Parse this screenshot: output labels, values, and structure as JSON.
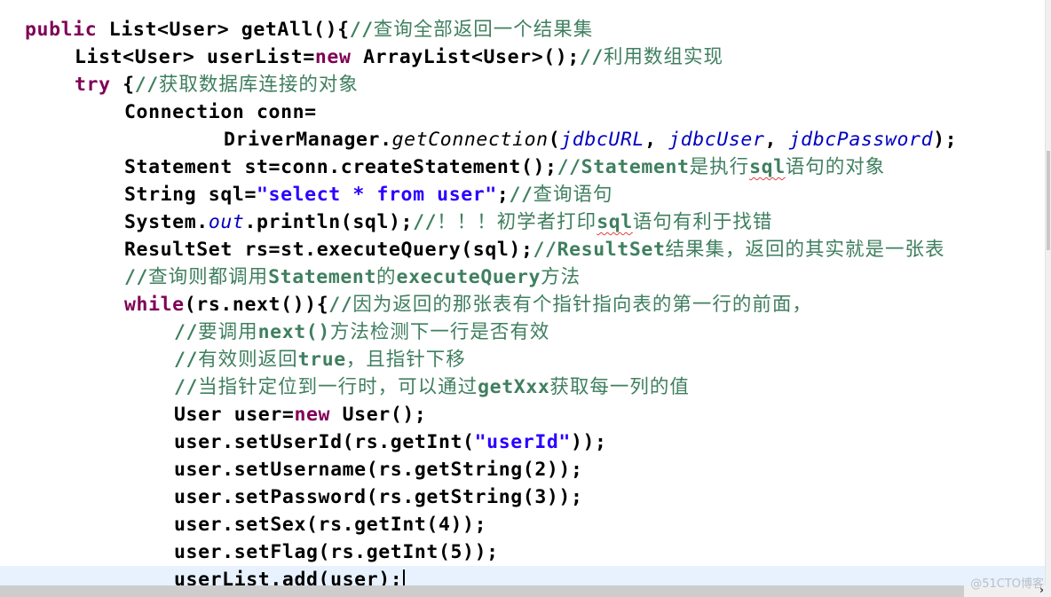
{
  "editor": {
    "language": "java",
    "colors": {
      "keyword": "#7f0055",
      "string": "#2a00ff",
      "field": "#0000c0",
      "comment": "#3f7f5f",
      "current_line": "#e8f2fe"
    },
    "lines": [
      {
        "indent": 0,
        "tokens": [
          {
            "t": "kw",
            "v": "public"
          },
          {
            "t": "p",
            "v": " List<User> getAll(){"
          },
          {
            "t": "cm",
            "v": "//",
            "cjk": "查询全部返回一个结果集"
          }
        ]
      },
      {
        "indent": 1,
        "tokens": [
          {
            "t": "p",
            "v": "List<User> userList="
          },
          {
            "t": "kw",
            "v": "new"
          },
          {
            "t": "p",
            "v": " ArrayList<User>();"
          },
          {
            "t": "cm",
            "v": "//",
            "cjk": "利用数组实现"
          }
        ]
      },
      {
        "indent": 1,
        "tokens": [
          {
            "t": "kw",
            "v": "try"
          },
          {
            "t": "p",
            "v": " {"
          },
          {
            "t": "cm",
            "v": "//",
            "cjk": "获取数据库连接的对象"
          }
        ]
      },
      {
        "indent": 2,
        "tokens": [
          {
            "t": "p",
            "v": "Connection conn="
          }
        ]
      },
      {
        "indent": 4,
        "tokens": [
          {
            "t": "p",
            "v": "DriverManager."
          },
          {
            "t": "sm",
            "v": "getConnection"
          },
          {
            "t": "p",
            "v": "("
          },
          {
            "t": "f",
            "v": "jdbcURL"
          },
          {
            "t": "p",
            "v": ", "
          },
          {
            "t": "f",
            "v": "jdbcUser"
          },
          {
            "t": "p",
            "v": ", "
          },
          {
            "t": "f",
            "v": "jdbcPassword"
          },
          {
            "t": "p",
            "v": ");"
          }
        ]
      },
      {
        "indent": 2,
        "tokens": [
          {
            "t": "p",
            "v": "Statement st=conn.createStatement();"
          },
          {
            "t": "cm",
            "v": "//Statement",
            "cjk": "是执行"
          },
          {
            "t": "cmsq",
            "v": "sql"
          },
          {
            "t": "cm",
            "v": "",
            "cjk": "语句的对象"
          }
        ]
      },
      {
        "indent": 2,
        "tokens": [
          {
            "t": "p",
            "v": "String sql="
          },
          {
            "t": "str",
            "v": "\"select * from user\""
          },
          {
            "t": "p",
            "v": ";"
          },
          {
            "t": "cm",
            "v": "//",
            "cjk": "查询语句"
          }
        ]
      },
      {
        "indent": 2,
        "tokens": [
          {
            "t": "p",
            "v": "System."
          },
          {
            "t": "sf",
            "v": "out"
          },
          {
            "t": "p",
            "v": ".println(sql);"
          },
          {
            "t": "cm",
            "v": "//",
            "cjk": "！！！初学者打印"
          },
          {
            "t": "cmsq",
            "v": "sql"
          },
          {
            "t": "cm",
            "v": "",
            "cjk": "语句有利于找错"
          }
        ]
      },
      {
        "indent": 2,
        "tokens": [
          {
            "t": "p",
            "v": "ResultSet rs=st.executeQuery(sql);"
          },
          {
            "t": "cm",
            "v": "//ResultSet",
            "cjk": "结果集，返回的其实就是一张表"
          }
        ]
      },
      {
        "indent": 2,
        "tokens": [
          {
            "t": "cm",
            "v": "//",
            "cjk": "查询则都调用"
          },
          {
            "t": "cm",
            "v": "Statement",
            "cjk": "的"
          },
          {
            "t": "cm",
            "v": "executeQuery",
            "cjk": "方法"
          }
        ]
      },
      {
        "indent": 2,
        "tokens": [
          {
            "t": "kw",
            "v": "while"
          },
          {
            "t": "p",
            "v": "(rs.next()){"
          },
          {
            "t": "cm",
            "v": "//",
            "cjk": "因为返回的那张表有个指针指向表的第一行的前面，"
          }
        ]
      },
      {
        "indent": 3,
        "tokens": [
          {
            "t": "cm",
            "v": "//",
            "cjk": "要调用"
          },
          {
            "t": "cm",
            "v": "next()",
            "cjk": "方法检测下一行是否有效"
          }
        ]
      },
      {
        "indent": 3,
        "tokens": [
          {
            "t": "cm",
            "v": "//",
            "cjk": "有效则返回"
          },
          {
            "t": "cm",
            "v": "true",
            "cjk": "，且指针下移"
          }
        ]
      },
      {
        "indent": 3,
        "tokens": [
          {
            "t": "cm",
            "v": "//",
            "cjk": "当指针定位到一行时，可以通过"
          },
          {
            "t": "cm",
            "v": "getXxx",
            "cjk": "获取每一列的值"
          }
        ]
      },
      {
        "indent": 3,
        "tokens": [
          {
            "t": "p",
            "v": "User user="
          },
          {
            "t": "kw",
            "v": "new"
          },
          {
            "t": "p",
            "v": " User();"
          }
        ]
      },
      {
        "indent": 3,
        "tokens": [
          {
            "t": "p",
            "v": "user.setUserId(rs.getInt("
          },
          {
            "t": "str",
            "v": "\"userId\""
          },
          {
            "t": "p",
            "v": "));"
          }
        ]
      },
      {
        "indent": 3,
        "tokens": [
          {
            "t": "p",
            "v": "user.setUsername(rs.getString(2));"
          }
        ]
      },
      {
        "indent": 3,
        "tokens": [
          {
            "t": "p",
            "v": "user.setPassword(rs.getString(3));"
          }
        ]
      },
      {
        "indent": 3,
        "tokens": [
          {
            "t": "p",
            "v": "user.setSex(rs.getInt(4));"
          }
        ]
      },
      {
        "indent": 3,
        "tokens": [
          {
            "t": "p",
            "v": "user.setFlag(rs.getInt(5));"
          }
        ]
      },
      {
        "indent": 3,
        "current": true,
        "caret": true,
        "tokens": [
          {
            "t": "p",
            "v": "userList.add(user);"
          }
        ]
      }
    ]
  },
  "scrollbars": {
    "vertical": {
      "position_fraction": 0.26,
      "visible_fraction": 0.17
    },
    "horizontal": {
      "position_fraction": 0.0,
      "visible_fraction": 0.92,
      "arrow": "›"
    }
  },
  "watermark": "@51CTO博客"
}
